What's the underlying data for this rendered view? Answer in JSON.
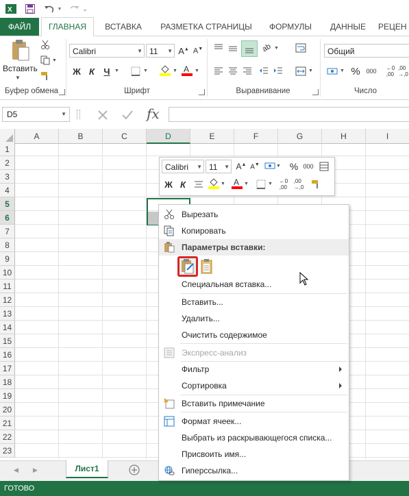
{
  "tabs": {
    "file": "ФАЙЛ",
    "home": "ГЛАВНАЯ",
    "insert": "ВСТАВКА",
    "page_layout": "РАЗМЕТКА СТРАНИЦЫ",
    "formulas": "ФОРМУЛЫ",
    "data": "ДАННЫЕ",
    "review": "РЕЦЕН"
  },
  "ribbon": {
    "paste_label": "Вставить",
    "font_name": "Calibri",
    "font_size": "11",
    "bold": "Ж",
    "italic": "К",
    "underline": "Ч",
    "number_format": "Общий",
    "percent": "%",
    "thousands": "000",
    "groups": {
      "clipboard": "Буфер обмена",
      "font": "Шрифт",
      "alignment": "Выравнивание",
      "number": "Число"
    }
  },
  "formula_bar": {
    "name_box": "D5",
    "fx": "fx",
    "value": ""
  },
  "grid": {
    "columns": [
      "A",
      "B",
      "C",
      "D",
      "E",
      "F",
      "G",
      "H",
      "I"
    ],
    "rows": [
      "1",
      "2",
      "3",
      "4",
      "5",
      "6",
      "7",
      "8",
      "9",
      "10",
      "11",
      "12",
      "13",
      "14",
      "15",
      "16",
      "17",
      "18",
      "19",
      "20",
      "21",
      "22",
      "23"
    ],
    "selected_cell": "D5"
  },
  "mini_toolbar": {
    "font_name": "Calibri",
    "font_size": "11",
    "percent": "%",
    "thousands": "000",
    "bold": "Ж",
    "italic": "К"
  },
  "context_menu": {
    "cut": "Вырезать",
    "copy": "Копировать",
    "paste_options": "Параметры вставки:",
    "paste_special": "Специальная вставка...",
    "insert": "Вставить...",
    "delete": "Удалить...",
    "clear": "Очистить содержимое",
    "quick_analysis": "Экспресс-анализ",
    "filter": "Фильтр",
    "sort": "Сортировка",
    "insert_comment": "Вставить примечание",
    "format_cells": "Формат ячеек...",
    "pick_from_list": "Выбрать из раскрывающегося списка...",
    "define_name": "Присвоить имя...",
    "hyperlink": "Гиперссылка..."
  },
  "sheets": {
    "active": "Лист1"
  },
  "status": {
    "text": "ГОТОВО"
  },
  "colors": {
    "accent": "#217346",
    "highlight_red": "#d9262a",
    "fill_yellow": "#ffff00",
    "font_red": "#ff0000"
  }
}
